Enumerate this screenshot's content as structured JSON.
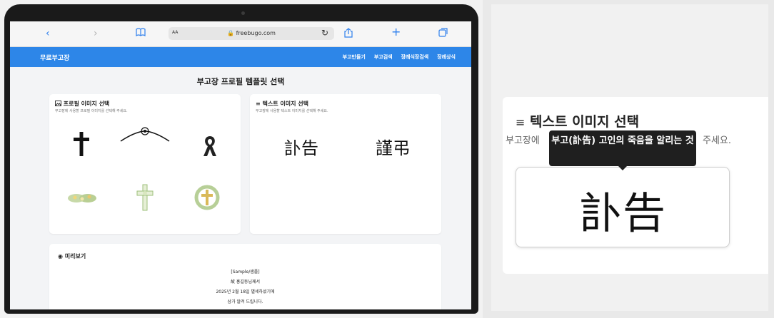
{
  "browser": {
    "url_host": "freebugo.com",
    "aa_label": "AA",
    "back_glyph": "‹",
    "forward_glyph": "›",
    "bookmarks_glyph": "📖",
    "reload_glyph": "↻",
    "share_glyph": "⇧",
    "new_tab_glyph": "+",
    "tabs_glyph": "⧉"
  },
  "site": {
    "brand": "무료부고장",
    "nav": [
      "부고만들기",
      "부고검색",
      "장례식장검색",
      "장례상식"
    ],
    "page_title": "부고장 프로필 템플릿 선택"
  },
  "profile_card": {
    "title": "프로필 이미지 선택",
    "subtitle": "부고장에 사용할 프로필 이미지를 선택해 주세요.",
    "icon": "image-icon"
  },
  "text_card": {
    "title": "텍스트 이미지 선택",
    "subtitle": "부고장에 사용할 텍스트 이미지를 선택해 주세요.",
    "icon": "text-lines-icon",
    "options": [
      "訃告",
      "謹弔"
    ]
  },
  "preview": {
    "title": "미리보기",
    "lines": [
      "[Sample/샘플]",
      "故 홍길동님께서",
      "2025년 2월 18일 별세하셨기에",
      "삼가 알려 드립니다."
    ]
  },
  "zoom": {
    "title": "텍스트 이미지 선택",
    "subtitle_left": "부고장에",
    "subtitle_right": "주세요.",
    "tooltip": "부고(訃告) 고인의 죽음을 알리는 것",
    "button_text": "訃告"
  },
  "colors": {
    "accent": "#2d86e8",
    "tooltip_bg": "#1f1f1f"
  }
}
